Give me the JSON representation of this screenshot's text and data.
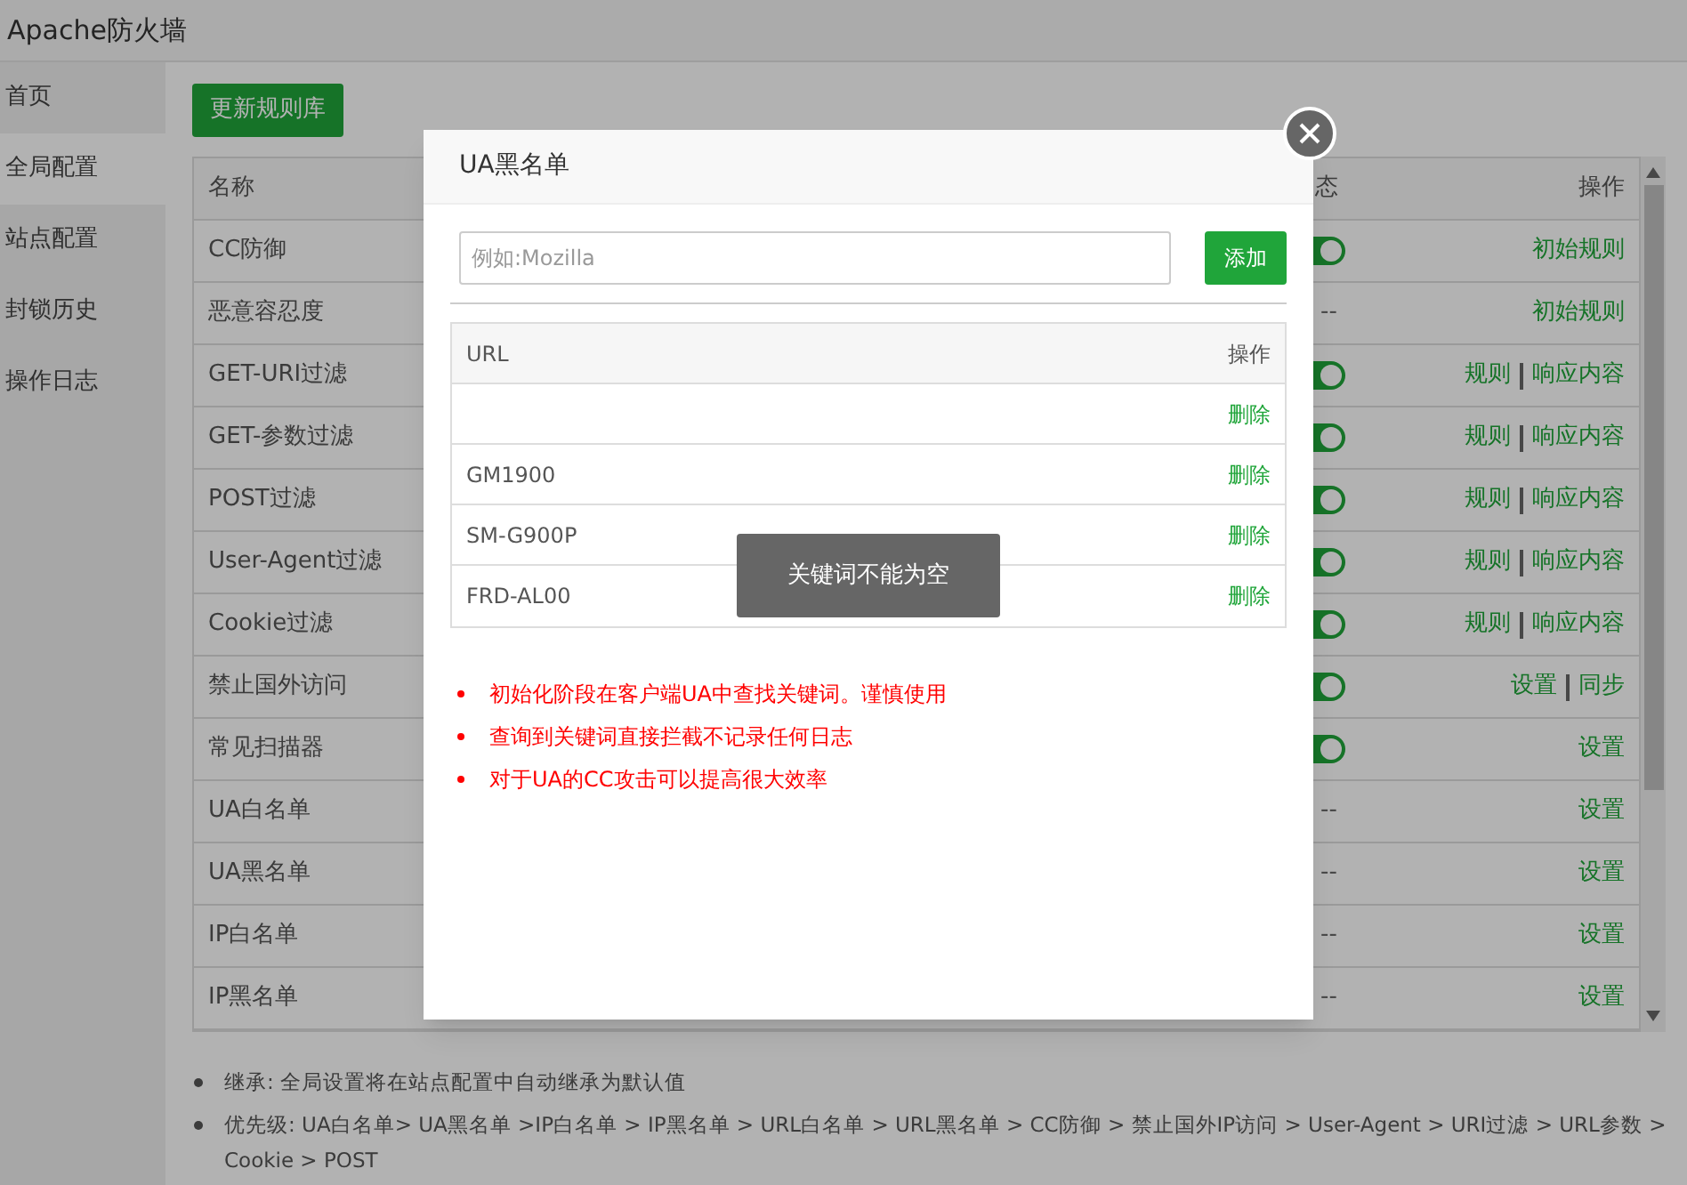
{
  "window": {
    "title": "Apache防火墙"
  },
  "sidebar": {
    "items": [
      {
        "label": "首页",
        "selected": false
      },
      {
        "label": "全局配置",
        "selected": true
      },
      {
        "label": "站点配置",
        "selected": false
      },
      {
        "label": "封锁历史",
        "selected": false
      },
      {
        "label": "操作日志",
        "selected": false
      }
    ]
  },
  "update_button": "更新规则库",
  "table": {
    "columns": [
      "名称",
      "态",
      "操作"
    ],
    "rows": [
      {
        "name": "CC防御",
        "status": {
          "kind": "switch",
          "on": true
        },
        "actions": [
          "初始规则"
        ]
      },
      {
        "name": "恶意容忍度",
        "status": {
          "kind": "text",
          "text": "--"
        },
        "actions": [
          "初始规则"
        ]
      },
      {
        "name": "GET-URI过滤",
        "status": {
          "kind": "switch",
          "on": true
        },
        "actions": [
          "规则",
          "响应内容"
        ]
      },
      {
        "name": "GET-参数过滤",
        "status": {
          "kind": "switch",
          "on": true
        },
        "actions": [
          "规则",
          "响应内容"
        ]
      },
      {
        "name": "POST过滤",
        "status": {
          "kind": "switch",
          "on": true
        },
        "actions": [
          "规则",
          "响应内容"
        ]
      },
      {
        "name": "User-Agent过滤",
        "status": {
          "kind": "switch",
          "on": true
        },
        "actions": [
          "规则",
          "响应内容"
        ]
      },
      {
        "name": "Cookie过滤",
        "status": {
          "kind": "switch",
          "on": true
        },
        "actions": [
          "规则",
          "响应内容"
        ]
      },
      {
        "name": "禁止国外访问",
        "status": {
          "kind": "switch",
          "on": true
        },
        "actions": [
          "设置",
          "同步"
        ]
      },
      {
        "name": "常见扫描器",
        "status": {
          "kind": "switch",
          "on": true
        },
        "actions": [
          "设置"
        ]
      },
      {
        "name": "UA白名单",
        "status": {
          "kind": "text",
          "text": "--"
        },
        "actions": [
          "设置"
        ]
      },
      {
        "name": "UA黑名单",
        "status": {
          "kind": "text",
          "text": "--"
        },
        "actions": [
          "设置"
        ]
      },
      {
        "name": "IP白名单",
        "status": {
          "kind": "text",
          "text": "--"
        },
        "actions": [
          "设置"
        ]
      },
      {
        "name": "IP黑名单",
        "status": {
          "kind": "text",
          "text": "--"
        },
        "actions": [
          "设置"
        ]
      }
    ]
  },
  "notes": [
    "继承: 全局设置将在站点配置中自动继承为默认值",
    "优先级: UA白名单> UA黑名单 >IP白名单 > IP黑名单 > URL白名单 > URL黑名单 > CC防御 > 禁止国外IP访问 > User-Agent > URI过滤 > URL参数 > Cookie > POST"
  ],
  "dialog": {
    "title": "UA黑名单",
    "input": {
      "placeholder": "例如:Mozilla"
    },
    "add_button": "添加",
    "columns": [
      "URL",
      "操作"
    ],
    "rows": [
      {
        "delete": "删除"
      },
      {
        "url": "GM1900",
        "delete": "删除"
      },
      {
        "url": "SM-G900P",
        "delete": "删除"
      },
      {
        "url": "FRD-AL00",
        "delete": "删除"
      }
    ],
    "tips": [
      "初始化阶段在客户端UA中查找关键词。谨慎使用",
      "查询到关键词直接拦截不记录任何日志",
      "对于UA的CC攻击可以提高很大效率"
    ],
    "toast": "关键词不能为空"
  }
}
